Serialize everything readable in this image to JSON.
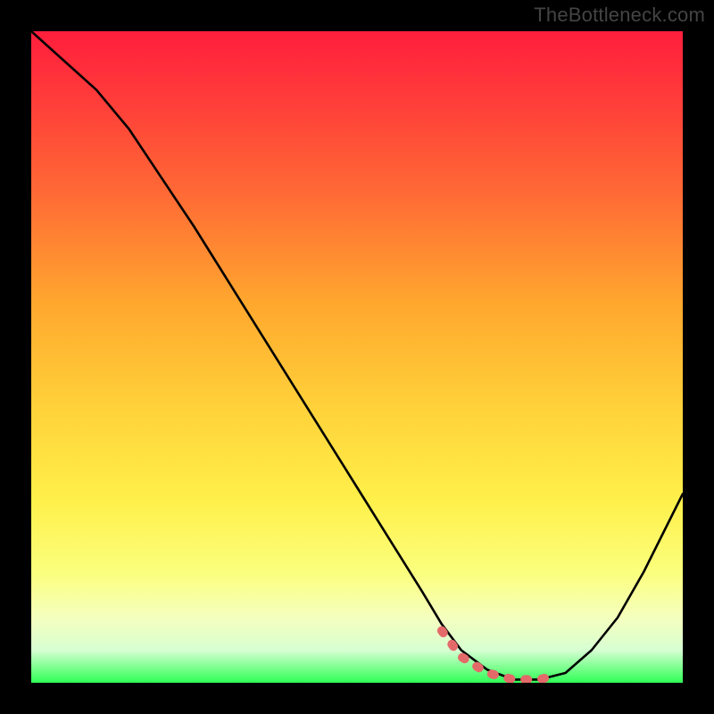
{
  "watermark": "TheBottleneck.com",
  "chart_data": {
    "type": "line",
    "title": "",
    "xlabel": "",
    "ylabel": "",
    "xlim": [
      0,
      100
    ],
    "ylim": [
      0,
      100
    ],
    "grid": false,
    "legend": false,
    "note": "No axis ticks or numeric labels are visible; x and y are normalized 0–100 from the plot area.",
    "series": [
      {
        "name": "curve",
        "color": "#000000",
        "x": [
          0,
          5,
          10,
          15,
          20,
          25,
          30,
          35,
          40,
          45,
          50,
          55,
          60,
          63,
          66,
          70,
          74,
          78,
          82,
          86,
          90,
          94,
          98,
          100
        ],
        "y": [
          100,
          95.5,
          91,
          85,
          77.5,
          70,
          62,
          54,
          46,
          38,
          30,
          22,
          14,
          9,
          5,
          2,
          0.5,
          0.5,
          1.5,
          5,
          10,
          17,
          25,
          29
        ]
      },
      {
        "name": "highlight-segment",
        "color": "#e46a6a",
        "thickness": "bold",
        "x": [
          63,
          66,
          70,
          74,
          78,
          80
        ],
        "y": [
          8,
          4,
          1.5,
          0.5,
          0.5,
          1
        ]
      }
    ],
    "background_gradient": {
      "direction": "top-to-bottom",
      "stops": [
        {
          "pos": 0,
          "color": "#ff1e3c"
        },
        {
          "pos": 25,
          "color": "#ff6a35"
        },
        {
          "pos": 58,
          "color": "#ffd23a"
        },
        {
          "pos": 83,
          "color": "#fbff7d"
        },
        {
          "pos": 95,
          "color": "#d7ffd2"
        },
        {
          "pos": 100,
          "color": "#2eff55"
        }
      ]
    }
  }
}
